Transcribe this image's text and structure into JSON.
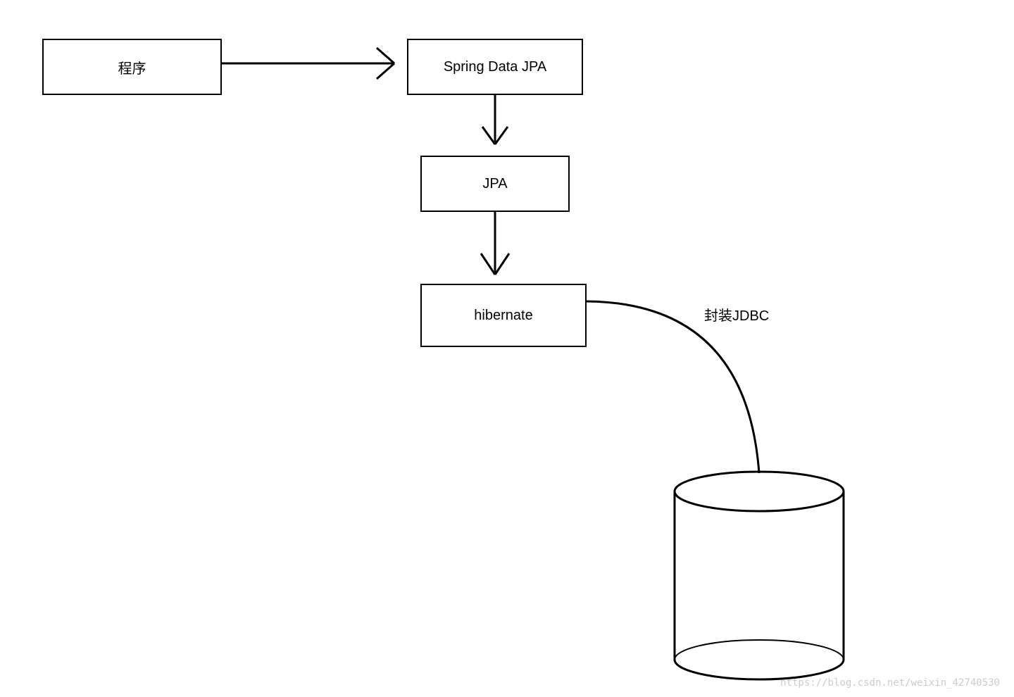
{
  "nodes": {
    "program": {
      "label": "程序"
    },
    "spring_data_jpa": {
      "label": "Spring Data JPA"
    },
    "jpa": {
      "label": "JPA"
    },
    "hibernate": {
      "label": "hibernate"
    }
  },
  "edge_labels": {
    "jdbc_wrap": "封装JDBC"
  },
  "watermark": "https://blog.csdn.net/weixin_42740530"
}
